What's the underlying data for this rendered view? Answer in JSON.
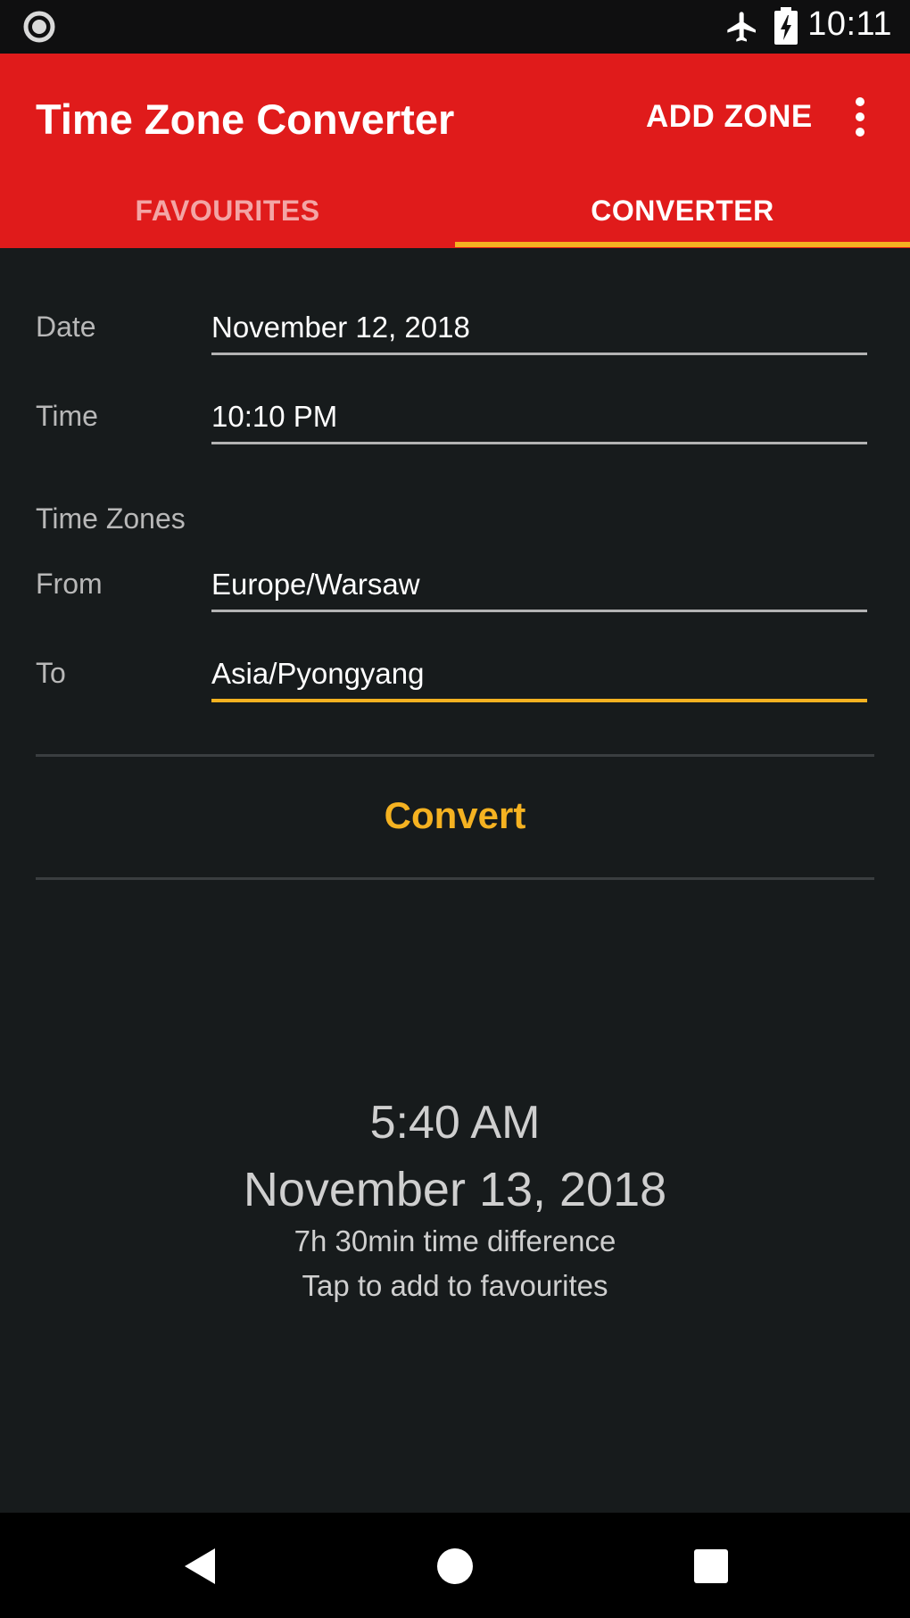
{
  "status_bar": {
    "time": "10:11",
    "icons": [
      "record-icon",
      "airplane-icon",
      "battery-charging-icon"
    ]
  },
  "app_bar": {
    "title": "Time Zone Converter",
    "add_zone_label": "ADD ZONE",
    "overflow_icon": "more-vert-icon",
    "color": "#e01b1b"
  },
  "tabs": [
    {
      "label": "FAVOURITES",
      "selected": false
    },
    {
      "label": "CONVERTER",
      "selected": true
    }
  ],
  "form": {
    "date_label": "Date",
    "date_value": "November 12, 2018",
    "time_label": "Time",
    "time_value": "10:10 PM",
    "zones_heading": "Time Zones",
    "from_label": "From",
    "from_value": "Europe/Warsaw",
    "to_label": "To",
    "to_value": "Asia/Pyongyang"
  },
  "convert_label": "Convert",
  "result": {
    "time": "5:40 AM",
    "date": "November 13, 2018",
    "difference": "7h 30min time difference",
    "hint": "Tap to add to favourites"
  },
  "accent_color": "#f5b221",
  "nav_bar": {
    "icons": [
      "back-icon",
      "home-icon",
      "recents-icon"
    ]
  }
}
